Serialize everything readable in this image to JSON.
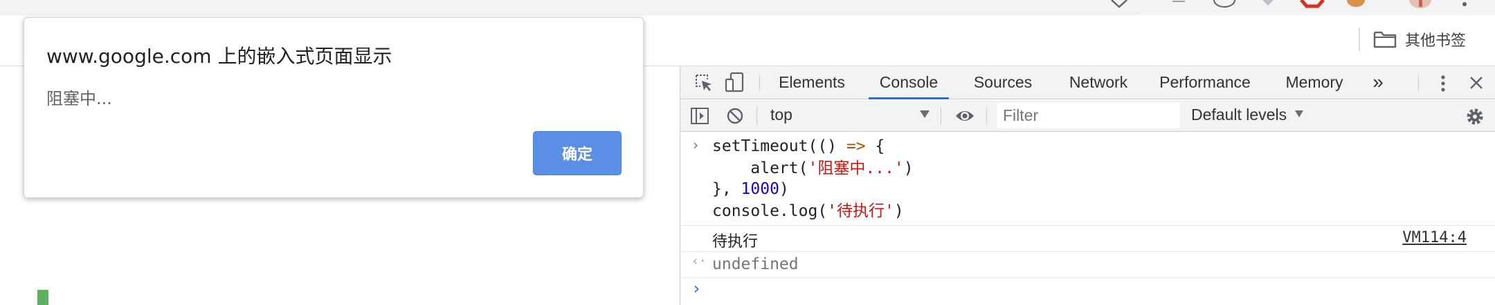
{
  "bookmarks_bar": {
    "folder_label": "其他书签"
  },
  "dialog": {
    "title": "www.google.com 上的嵌入式页面显示",
    "message": "阻塞中...",
    "ok_label": "确定"
  },
  "devtools": {
    "tabs": [
      {
        "label": "Elements",
        "active": false
      },
      {
        "label": "Console",
        "active": true
      },
      {
        "label": "Sources",
        "active": false
      },
      {
        "label": "Network",
        "active": false
      },
      {
        "label": "Performance",
        "active": false
      },
      {
        "label": "Memory",
        "active": false
      }
    ],
    "more_tabs_glyph": "»",
    "context": "top",
    "filter_placeholder": "Filter",
    "levels_label": "Default levels",
    "console": {
      "input_lines": [
        "setTimeout(() => {",
        "    alert('阻塞中...')",
        "}, 1000)",
        "console.log('待执行')"
      ],
      "log_output": "待执行",
      "log_source": "VM114:4",
      "return_value": "undefined"
    },
    "colors": {
      "active_tab_underline": "#1a73e8",
      "string": "#c41a16",
      "number": "#1c00cf",
      "prompt": "#1a73e8"
    }
  },
  "colors": {
    "dialog_button": "#5b8fe6"
  }
}
